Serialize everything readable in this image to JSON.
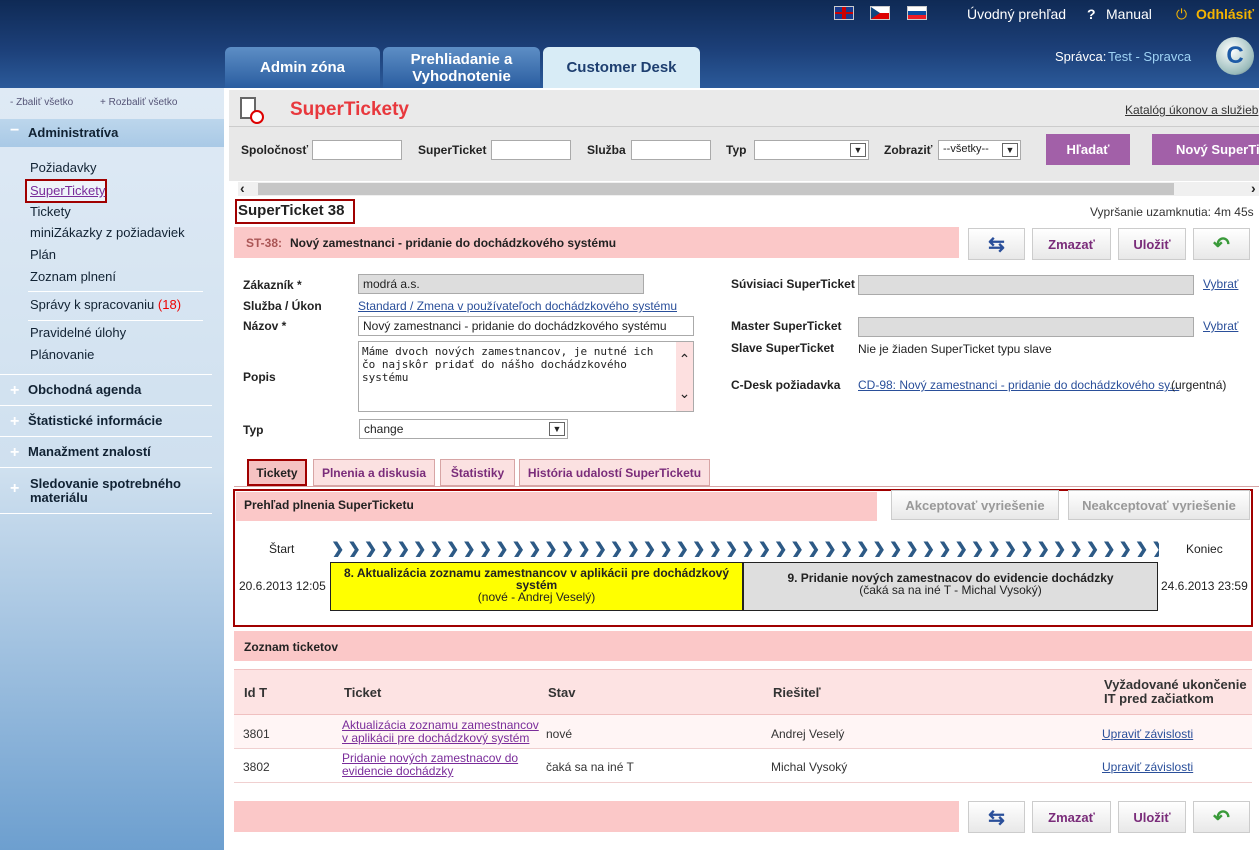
{
  "top": {
    "flags": [
      "flag-uk-icon",
      "flag-cz-icon",
      "flag-sk-icon"
    ],
    "links": {
      "overview": "Úvodný prehľad",
      "manual": "Manual",
      "logout": "Odhlásiť"
    },
    "tabs": [
      "Admin zóna",
      "Prehliadanie a Vyhodnotenie",
      "Customer Desk"
    ],
    "admin_label": "Správca:",
    "admin_name": "Test - Spravca"
  },
  "sidebar": {
    "collapse_all": "- Zbaliť všetko",
    "expand_all": "+ Rozbaliť všetko",
    "section": "Administratíva",
    "items": [
      "Požiadavky",
      "SuperTickety",
      "Tickety",
      "miniZákazky z požiadaviek",
      "Plán",
      "Zoznam plnení"
    ],
    "reports_label": "Správy k spracovaniu",
    "reports_count": "(18)",
    "items2": [
      "Pravidelné úlohy",
      "Plánovanie"
    ],
    "sections": [
      "Obchodná agenda",
      "Štatistické informácie",
      "Manažment znalostí",
      "Sledovanie spotrebného materiálu"
    ]
  },
  "header": {
    "title": "SuperTickety",
    "catalog_link": "Katalóg úkonov a služieb"
  },
  "filters": {
    "company": "Spoločnosť",
    "superticket": "SuperTicket",
    "service": "Služba",
    "type": "Typ",
    "show": "Zobraziť",
    "show_value": "--všetky--",
    "search_btn": "Hľadať",
    "new_btn": "Nový SuperTi"
  },
  "ticket": {
    "title": "SuperTicket 38",
    "lock": "Vypršanie uzamknutia: 4m 45s",
    "id": "ST-38:",
    "name": "Nový zamestnanci - pridanie do dochádzkového systému",
    "btn_delete": "Zmazať",
    "btn_save": "Uložiť"
  },
  "form": {
    "customer_label": "Zákazník *",
    "customer_value": "modrá a.s.",
    "service_label": "Služba / Úkon",
    "service_value": "Standard / Zmena v používateľoch dochádzkového systému",
    "name_label": "Názov *",
    "name_value": "Nový zamestnanci - pridanie do dochádzkového systému",
    "desc_label": "Popis",
    "desc_value": "Máme dvoch nových zamestnancov, je nutné ich čo najskôr pridať do nášho dochádzkového systému",
    "type_label": "Typ",
    "type_value": "change",
    "related_label": "Súvisiaci SuperTicket",
    "select_link": "Vybrať",
    "master_label": "Master SuperTicket",
    "slave_label": "Slave SuperTicket",
    "slave_value": "Nie je žiaden SuperTicket typu slave",
    "cdesk_label": "C-Desk požiadavka",
    "cdesk_link": "CD-98: Nový zamestnanci - pridanie do dochádzkového sy...",
    "cdesk_priority": "(urgentná)"
  },
  "subtabs": [
    "Tickety",
    "Plnenia a diskusia",
    "Štatistiky",
    "História udalostí SuperTicketu"
  ],
  "progress": {
    "title": "Prehľad plnenia SuperTicketu",
    "accept": "Akceptovať vyriešenie",
    "reject": "Neakceptovať vyriešenie",
    "start_label": "Štart",
    "end_label": "Koniec",
    "start_date": "20.6.2013 12:05",
    "end_date": "24.6.2013 23:59",
    "step1_title": "8.   Aktualizácia zoznamu zamestnancov v aplikácii pre dochádzkový systém",
    "step1_sub": "(nové - Andrej Veselý)",
    "step2_title": "9.   Pridanie nových zamestnacov do evidencie dochádzky",
    "step2_sub": "(čaká sa na iné T - Michal Vysoký)"
  },
  "list": {
    "title": "Zoznam ticketov",
    "headers": [
      "Id T",
      "Ticket",
      "Stav",
      "Riešiteľ",
      "Vyžadované ukončenie IT pred začiatkom"
    ],
    "rows": [
      {
        "id": "3801",
        "ticket": "Aktualizácia zoznamu zamestnancov v aplikácii pre dochádzkový systém",
        "state": "nové",
        "solver": "Andrej Veselý",
        "action": "Upraviť závislosti"
      },
      {
        "id": "3802",
        "ticket": "Pridanie nových zamestnacov do evidencie dochádzky",
        "state": "čaká sa na iné T",
        "solver": "Michal Vysoký",
        "action": "Upraviť závislosti"
      }
    ]
  },
  "colors": {
    "accent": "#a260a8",
    "pink": "#f9b7b7",
    "highlight": "#ffff00",
    "tab_active": "#d8ecf6"
  }
}
